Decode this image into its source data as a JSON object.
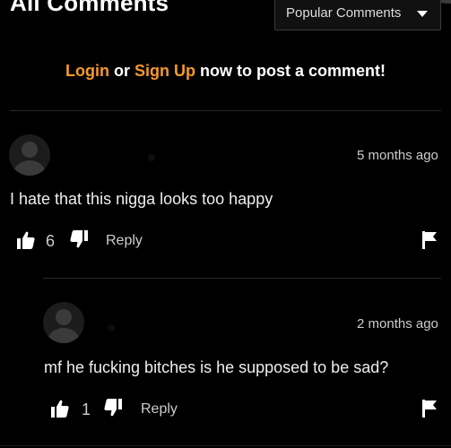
{
  "header": {
    "title": "All Comments",
    "sort_label": "Popular Comments"
  },
  "login_prompt": {
    "login": "Login",
    "or": "or",
    "signup": "Sign Up",
    "rest": "now to post a comment!"
  },
  "comments": [
    {
      "time": "5 months ago",
      "text": "I hate that this nigga looks too happy",
      "likes": "6",
      "reply_label": "Reply"
    },
    {
      "time": "2 months ago",
      "text": "mf he fucking bitches is he supposed to be sad?",
      "likes": "1",
      "reply_label": "Reply"
    }
  ],
  "icons": [
    "thumbs-up-icon",
    "thumbs-down-icon",
    "flag-icon",
    "caret-down-icon",
    "avatar-icon"
  ],
  "colors": {
    "accent": "#f79a26",
    "background": "#000000"
  }
}
